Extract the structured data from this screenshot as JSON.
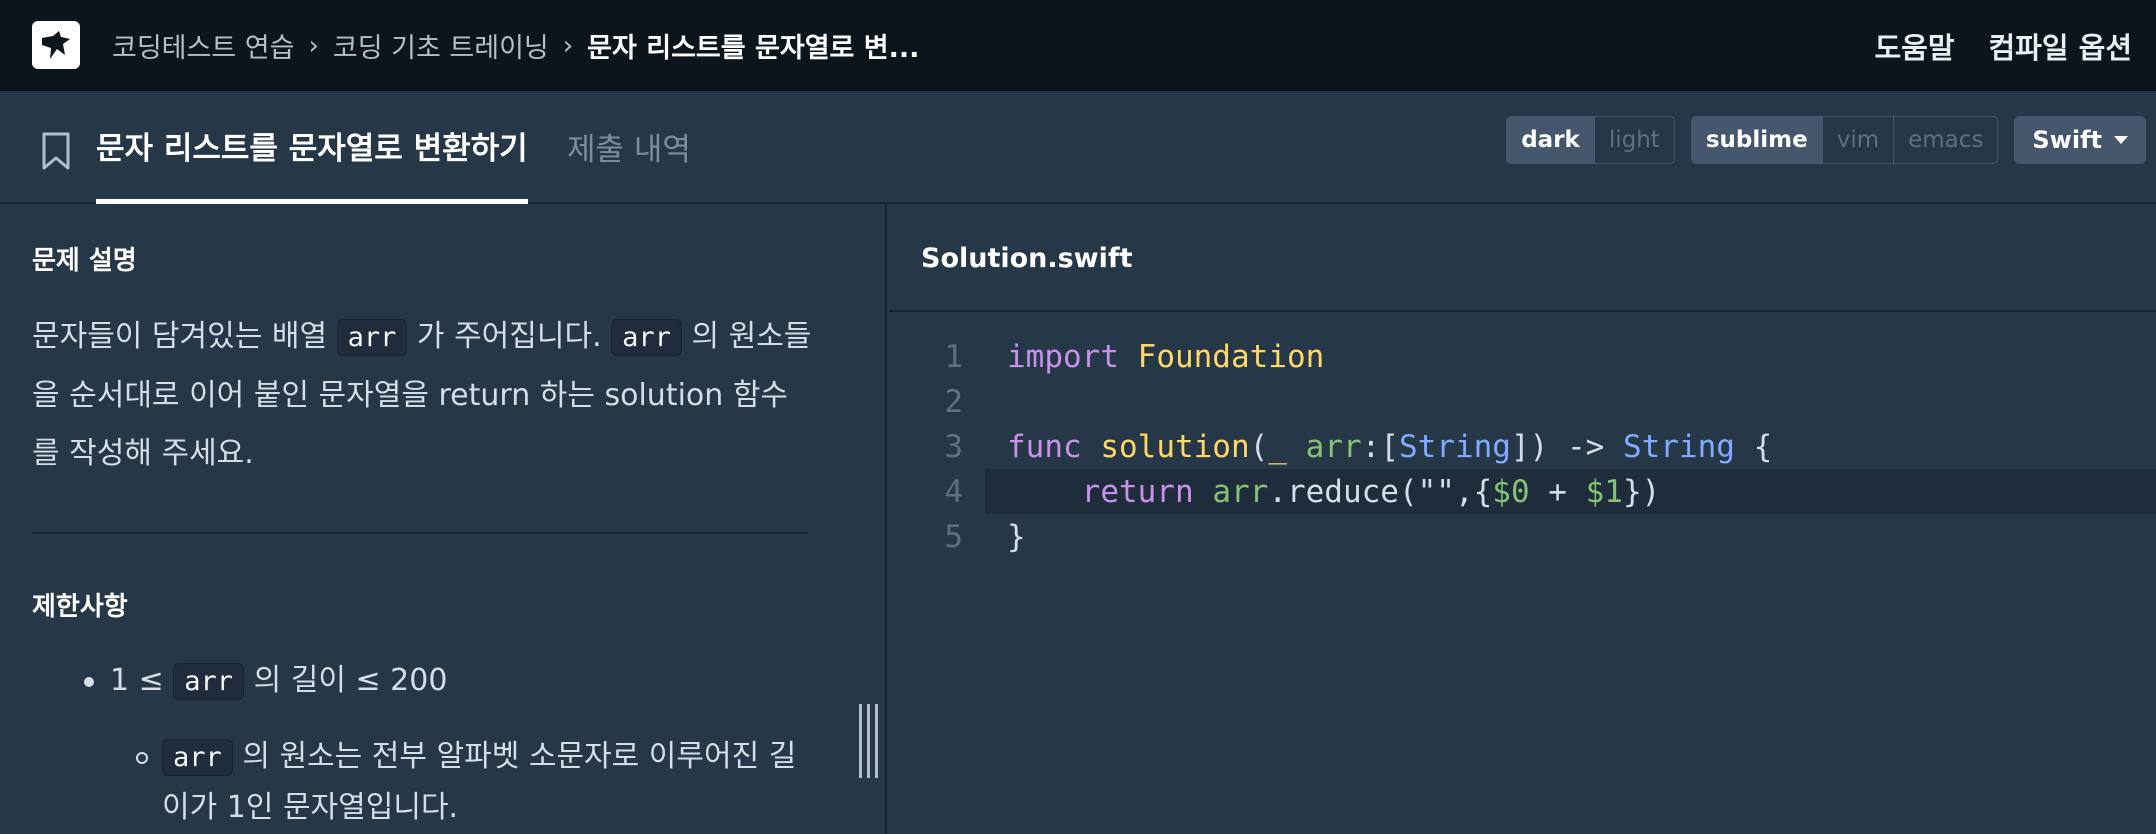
{
  "breadcrumb": {
    "items": [
      "코딩테스트 연습",
      "코딩 기초 트레이닝"
    ],
    "current": "문자 리스트를 문자열로 변..."
  },
  "topnav": {
    "help": "도움말",
    "compile_options": "컴파일 옵션"
  },
  "tabs": {
    "problem": "문자 리스트를 문자열로 변환하기",
    "submissions": "제출 내역"
  },
  "toggles": {
    "theme": [
      {
        "label": "dark",
        "active": true
      },
      {
        "label": "light",
        "active": false
      }
    ],
    "keymap": [
      {
        "label": "sublime",
        "active": true
      },
      {
        "label": "vim",
        "active": false
      },
      {
        "label": "emacs",
        "active": false
      }
    ],
    "language": "Swift"
  },
  "problem": {
    "desc_title": "문제 설명",
    "desc": {
      "t1": "문자들이 담겨있는 배열 ",
      "code1": "arr",
      "t2": " 가 주어집니다. ",
      "code2": "arr",
      "t3": " 의 원소들을 순서대로 이어 붙인 문자열을 return 하는 solution 함수를 작성해 주세요."
    },
    "constraints_title": "제한사항",
    "c1": {
      "pre": "1 ≤ ",
      "code": "arr",
      "post": " 의 길이 ≤ 200"
    },
    "c2": {
      "code": "arr",
      "post": " 의 원소는 전부 알파벳 소문자로 이루어진 길이가 1인 문자열입니다."
    }
  },
  "editor": {
    "file_name": "Solution.swift",
    "line_numbers": [
      "1",
      "2",
      "3",
      "4",
      "5"
    ],
    "l1": {
      "kw": "import",
      "name": "Foundation"
    },
    "l3": {
      "kw": "func",
      "fn": "solution",
      "p1": "(",
      "us": "_",
      "arg": "arr",
      "p2": ":[",
      "t1": "String",
      "p3": "]) -> ",
      "t2": "String",
      "p4": " {"
    },
    "l4": {
      "indent": "    ",
      "kw": "return",
      "arg": "arr",
      "p1": ".reduce(\"\",{",
      "d0": "$0",
      "p2": " + ",
      "d1": "$1",
      "p3": "})"
    },
    "l5": {
      "p": "}"
    }
  },
  "colors": {
    "nav_bg": "#0c151c",
    "panel_bg": "#263747",
    "keyword": "#c792ea",
    "type": "#82aaff",
    "function": "#ffd866",
    "argument": "#84c275"
  }
}
